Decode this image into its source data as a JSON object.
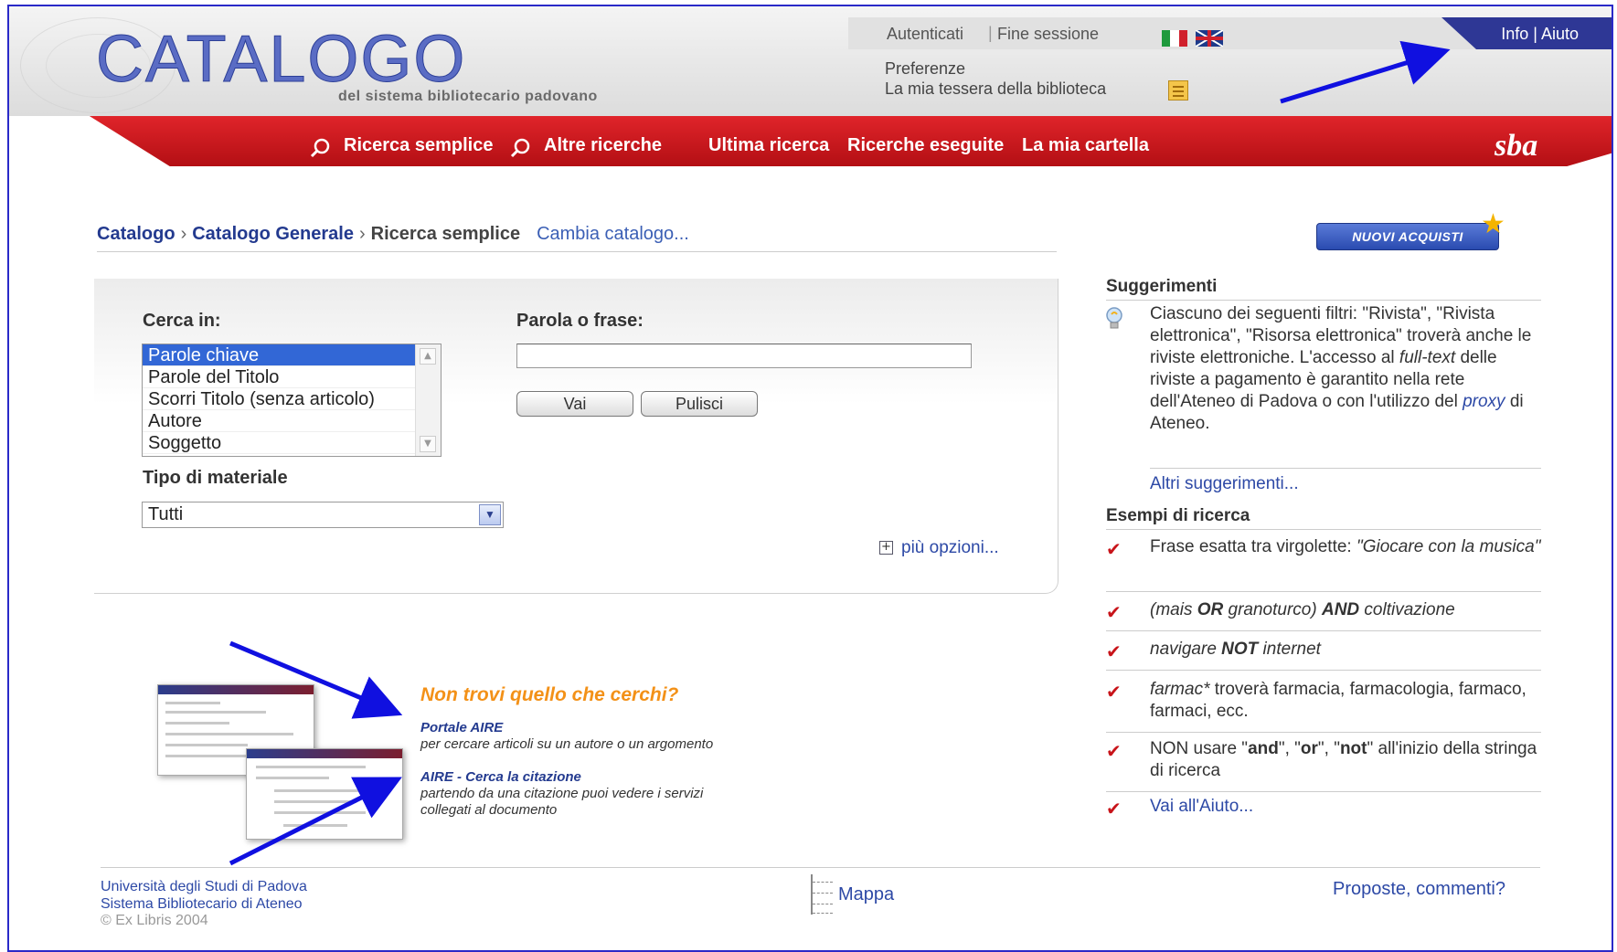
{
  "header": {
    "logo_title": "CATALOGO",
    "logo_subtitle": "del sistema bibliotecario padovano",
    "auth": "Autenticati",
    "end_session": "Fine sessione",
    "info_help": "Info | Aiuto",
    "preferences": "Preferenze",
    "library_card": "La mia tessera della biblioteca"
  },
  "nav": {
    "simple_search": "Ricerca semplice",
    "other_searches": "Altre ricerche",
    "last_search": "Ultima ricerca",
    "searches_done": "Ricerche eseguite",
    "my_folder": "La mia cartella",
    "brand": "sba"
  },
  "breadcrumb": {
    "catalog": "Catalogo",
    "general": "Catalogo Generale",
    "current": "Ricerca semplice",
    "change": "Cambia catalogo..."
  },
  "nuovi_acquisti": "NUOVI ACQUISTI",
  "search": {
    "search_in_label": "Cerca in:",
    "search_in_options": [
      "Parole chiave",
      "Parole del Titolo",
      "Scorri Titolo (senza articolo)",
      "Autore",
      "Soggetto"
    ],
    "selected_index": 0,
    "material_label": "Tipo di materiale",
    "material_value": "Tutti",
    "phrase_label": "Parola o frase:",
    "phrase_value": "",
    "go_button": "Vai",
    "clear_button": "Pulisci",
    "more_options": "più opzioni..."
  },
  "suggestions": {
    "title": "Suggerimenti",
    "text_1": "Ciascuno dei seguenti filtri: \"Rivista\", \"Rivista elettronica\", \"Risorsa elettronica\" troverà anche le riviste elettroniche. L'accesso al ",
    "text_em": "full-text",
    "text_2": " delle riviste a pagamento è garantito nella rete dell'Ateneo di Padova o con l'utilizzo del ",
    "text_proxy": "proxy",
    "text_3": " di Ateneo.",
    "more": "Altri suggerimenti..."
  },
  "examples": {
    "title": "Esempi di ricerca",
    "ex1_a": "Frase esatta tra virgolette: ",
    "ex1_b": "\"Giocare con la musica\"",
    "ex2_a": "(mais ",
    "ex2_or": "OR",
    "ex2_b": " granoturco) ",
    "ex2_and": "AND",
    "ex2_c": " coltivazione",
    "ex3_a": "navigare ",
    "ex3_not": "NOT",
    "ex3_b": " internet",
    "ex4_a": "farmac*",
    "ex4_b": " troverà farmacia, farmacologia, farmaco, farmaci, ecc.",
    "ex5_a": "NON usare \"",
    "ex5_and": "and",
    "ex5_b": "\", \"",
    "ex5_or": "or",
    "ex5_c": "\", \"",
    "ex5_not": "not",
    "ex5_d": "\" all'inizio della stringa di ricerca",
    "help_link": "Vai all'Aiuto..."
  },
  "aire": {
    "headline": "Non trovi quello che cerchi?",
    "portal_link": "Portale AIRE",
    "portal_desc": "per cercare articoli su un autore o un argomento",
    "cite_link": "AIRE - Cerca la citazione",
    "cite_desc_1": "partendo da una citazione puoi vedere i servizi",
    "cite_desc_2": "collegati al documento"
  },
  "footer": {
    "university": "Università degli Studi di Padova",
    "system": "Sistema Bibliotecario di Ateneo",
    "copyright": "© Ex Libris 2004",
    "map": "Mappa",
    "feedback": "Proposte, commenti?"
  },
  "colors": {
    "nav_red": "#c8141a",
    "link_blue": "#2d49a6",
    "annotation_arrow": "#1010e0",
    "headline_orange": "#f39118"
  }
}
